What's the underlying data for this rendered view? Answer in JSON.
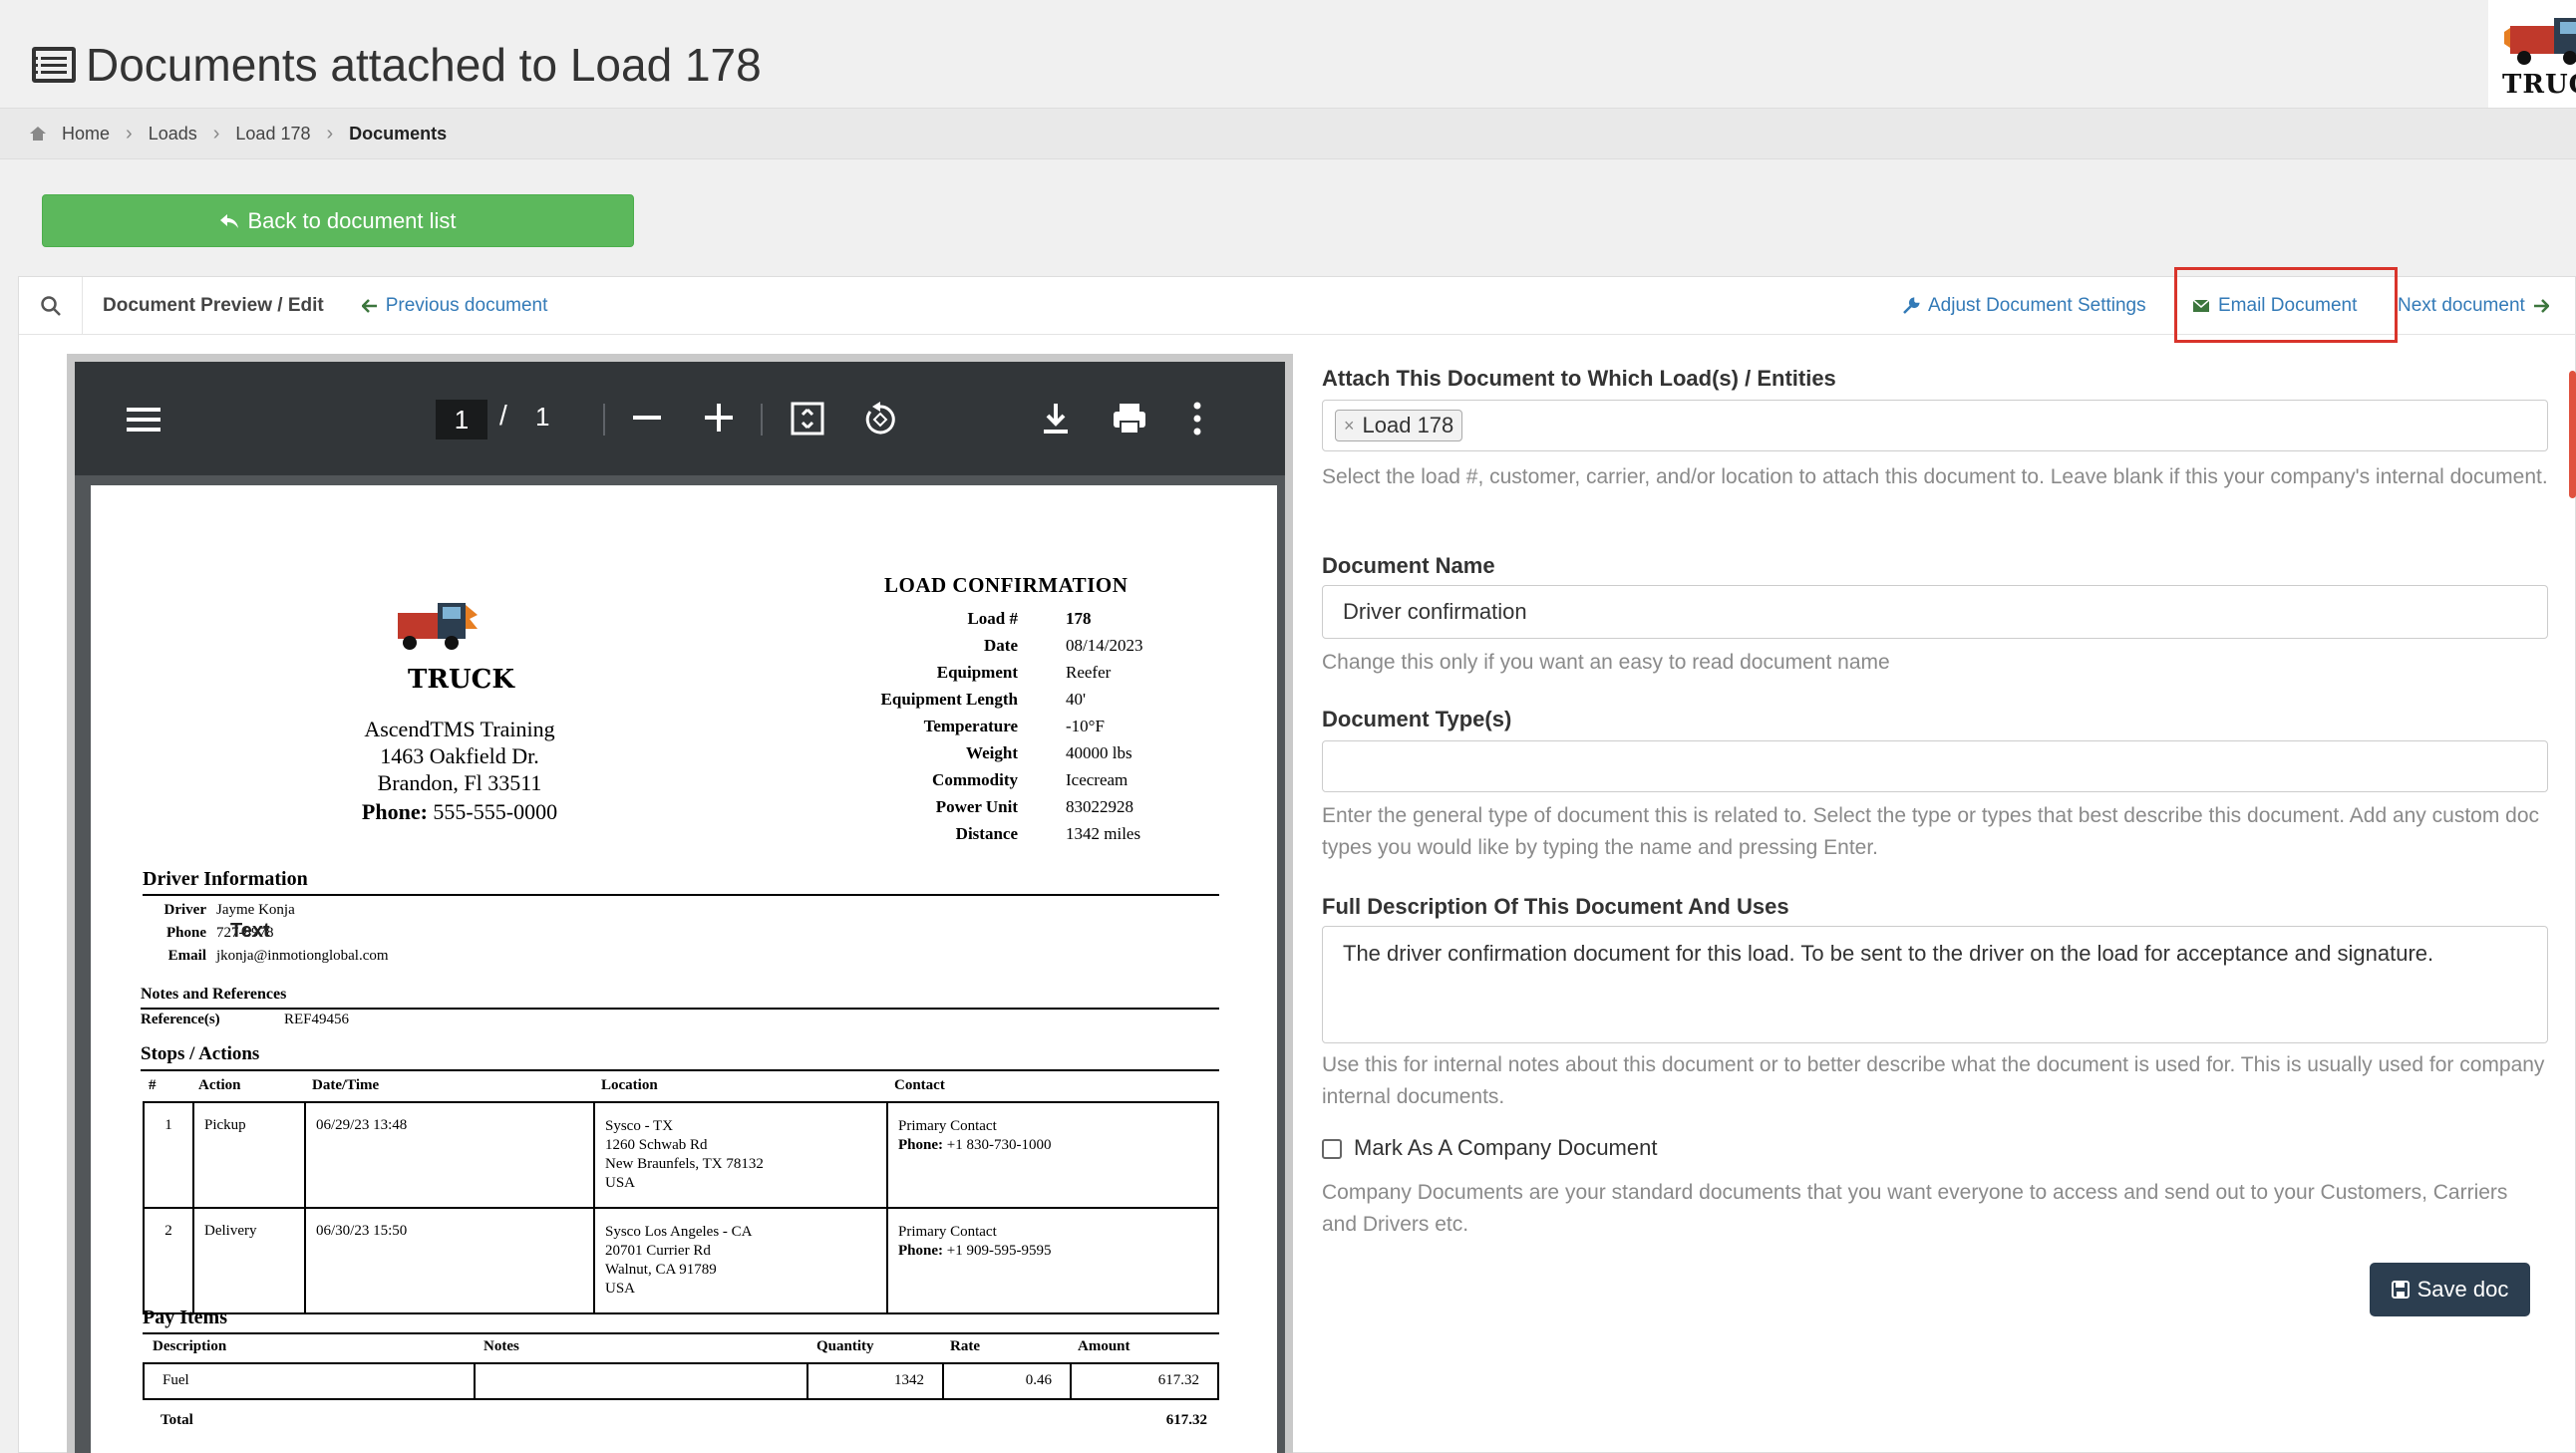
{
  "header": {
    "title": "Documents attached to Load 178",
    "logo_text": "TRUCK"
  },
  "breadcrumb": [
    {
      "label": "Home"
    },
    {
      "label": "Loads"
    },
    {
      "label": "Load 178"
    },
    {
      "label": "Documents"
    }
  ],
  "back_button": {
    "label": "Back to document list"
  },
  "toolbar": {
    "title": "Document Preview / Edit",
    "previous": "Previous document",
    "adjust": "Adjust Document Settings",
    "email": "Email Document",
    "next": "Next document"
  },
  "viewer": {
    "page_current": "1",
    "page_separator": "/",
    "page_total": "1"
  },
  "doc": {
    "heading": "LOAD CONFIRMATION",
    "logo_text": "TRUCK",
    "company": {
      "name": "AscendTMS Training",
      "address1": "1463 Oakfield Dr.",
      "address2": "Brandon, Fl 33511",
      "phone_label": "Phone:",
      "phone": "555-555-0000"
    },
    "details": [
      {
        "key": "Load #",
        "value": "178"
      },
      {
        "key": "Date",
        "value": "08/14/2023"
      },
      {
        "key": "Equipment",
        "value": "Reefer"
      },
      {
        "key": "Equipment Length",
        "value": "40'"
      },
      {
        "key": "Temperature",
        "value": "-10°F"
      },
      {
        "key": "Weight",
        "value": "40000 lbs"
      },
      {
        "key": "Commodity",
        "value": "Icecream"
      },
      {
        "key": "Power Unit",
        "value": "83022928"
      },
      {
        "key": "Distance",
        "value": "1342 miles"
      }
    ],
    "driver_section": "Driver Information",
    "driver": {
      "driver_label": "Driver",
      "driver_value": "Jayme Konja",
      "phone_label": "Phone",
      "phone_value": "727-8978",
      "email_label": "Email",
      "email_value": "jkonja@inmotionglobal.com",
      "overlay_text": "Text"
    },
    "notes_section": "Notes and References",
    "reference_label": "Reference(s)",
    "reference_value": "REF49456",
    "stops_section": "Stops / Actions",
    "stops_headers": [
      "#",
      "Action",
      "Date/Time",
      "Location",
      "Contact"
    ],
    "stops": [
      {
        "num": "1",
        "action": "Pickup",
        "datetime": "06/29/23 13:48",
        "loc1": "Sysco - TX",
        "loc2": "1260 Schwab Rd",
        "loc3": "New Braunfels, TX 78132",
        "loc4": "USA",
        "contact": "Primary Contact",
        "phone_label": "Phone:",
        "phone": "+1 830-730-1000"
      },
      {
        "num": "2",
        "action": "Delivery",
        "datetime": "06/30/23 15:50",
        "loc1": "Sysco Los Angeles - CA",
        "loc2": "20701 Currier Rd",
        "loc3": "Walnut, CA 91789",
        "loc4": "USA",
        "contact": "Primary Contact",
        "phone_label": "Phone:",
        "phone": "+1 909-595-9595"
      }
    ],
    "pay_section": "Pay Items",
    "pay_headers": [
      "Description",
      "Notes",
      "Quantity",
      "Rate",
      "Amount"
    ],
    "pay_row": {
      "description": "Fuel",
      "notes": "",
      "quantity": "1342",
      "rate": "0.46",
      "amount": "617.32"
    },
    "total_label": "Total",
    "total_value": "617.32"
  },
  "form": {
    "attach_label": "Attach This Document to Which Load(s) / Entities",
    "attach_tag": "Load 178",
    "attach_help": "Select the load #, customer, carrier, and/or location to attach this document to. Leave blank if this your company's internal document.",
    "name_label": "Document Name",
    "name_value": "Driver confirmation",
    "name_help": "Change this only if you want an easy to read document name",
    "type_label": "Document Type(s)",
    "type_value": "",
    "type_help": "Enter the general type of document this is related to. Select the type or types that best describe this document. Add any custom doc types you would like by typing the name and pressing Enter.",
    "desc_label": "Full Description Of This Document And Uses",
    "desc_value": "The driver confirmation document for this load. To be sent to the driver on the load for acceptance and signature.",
    "desc_help": "Use this for internal notes about this document or to better describe what the document is used for. This is usually used for company internal documents.",
    "company_doc_label": "Mark As A Company Document",
    "company_doc_checked": false,
    "company_doc_help": "Company Documents are your standard documents that you want everyone to access and send out to your Customers, Carriers and Drivers etc.",
    "save_label": "Save doc"
  },
  "colors": {
    "back_button": "#5cb85c",
    "link": "#337ab7",
    "highlight": "#d9342b",
    "save_button": "#2c3e50",
    "viewer_bar": "#323639"
  }
}
